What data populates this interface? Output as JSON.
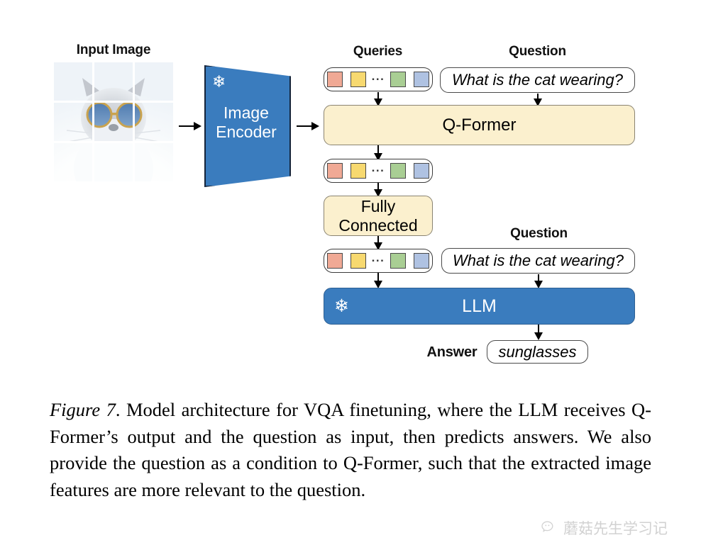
{
  "figure": {
    "labels": {
      "input_image": "Input Image",
      "queries": "Queries",
      "question": "Question",
      "answer": "Answer"
    },
    "blocks": {
      "image_encoder": "Image\nEncoder",
      "image_encoder_line1": "Image",
      "image_encoder_line2": "Encoder",
      "q_former": "Q-Former",
      "fully_connected_line1": "Fully",
      "fully_connected_line2": "Connected",
      "llm": "LLM"
    },
    "fields": {
      "question_top": "What is the cat wearing?",
      "question_bottom": "What is the cat wearing?",
      "answer": "sunglasses"
    },
    "icons": {
      "frozen": "snowflake-icon",
      "ellipsis": "..."
    },
    "query_tokens": [
      {
        "name": "token-salmon",
        "color": "#F0A995"
      },
      {
        "name": "token-yellow",
        "color": "#F7D970"
      },
      {
        "name": "token-green",
        "color": "#A9CE94"
      },
      {
        "name": "token-blue",
        "color": "#AFC2E2"
      }
    ],
    "colors": {
      "frozen_block": "#3A7CBE",
      "trainable_block": "#FBF0CE",
      "text_box": "#FFFFFF",
      "arrow": "#000000"
    }
  },
  "caption": {
    "figure_number": "Figure 7",
    "text": ". Model architecture for VQA finetuning, where the LLM receives Q-Former’s output and the question as input, then predicts answers. We also provide the question as a condition to Q-Former, such that the extracted image features are more relevant to the question."
  },
  "watermark": {
    "text": "蘑菇先生学习记"
  }
}
